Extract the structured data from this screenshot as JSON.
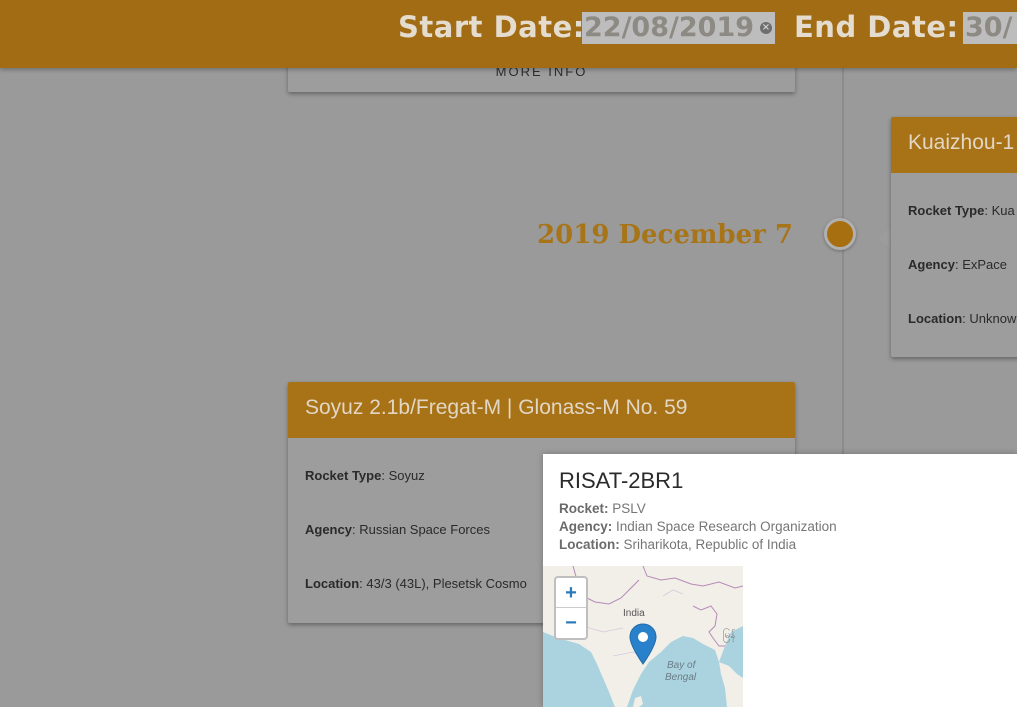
{
  "header": {
    "start_label": "Start Date:",
    "start_value": "22/08/2019",
    "end_label": "End Date:",
    "end_value": "30/"
  },
  "timeline": {
    "more_info": "MORE INFO",
    "date_label": "2019 December 7"
  },
  "cards": {
    "soyuz": {
      "title": "Soyuz 2.1b/Fregat-M | Glonass-M No. 59",
      "rocket_key": "Rocket Type",
      "rocket_val": "Soyuz",
      "agency_key": "Agency",
      "agency_val": "Russian Space Forces",
      "location_key": "Location",
      "location_val": "43/3 (43L), Plesetsk Cosmo"
    },
    "kuaizhou": {
      "title": "Kuaizhou-1",
      "rocket_key": "Rocket Type",
      "rocket_val": "Kua",
      "agency_key": "Agency",
      "agency_val": "ExPace",
      "location_key": "Location",
      "location_val": "Unknow"
    }
  },
  "popup": {
    "title": "RISAT-2BR1",
    "rocket_key": "Rocket:",
    "rocket_val": "PSLV",
    "agency_key": "Agency:",
    "agency_val": "Indian Space Research Organization",
    "location_key": "Location:",
    "location_val": "Sriharikota, Republic of India",
    "map": {
      "zoom_in": "+",
      "zoom_out": "−",
      "label_india": "India",
      "label_bay1": "Bay of",
      "label_bay2": "Bengal",
      "label_myanmar": "မြန်"
    }
  },
  "colors": {
    "accent": "#a16c14",
    "marker": "#2a81cb"
  }
}
